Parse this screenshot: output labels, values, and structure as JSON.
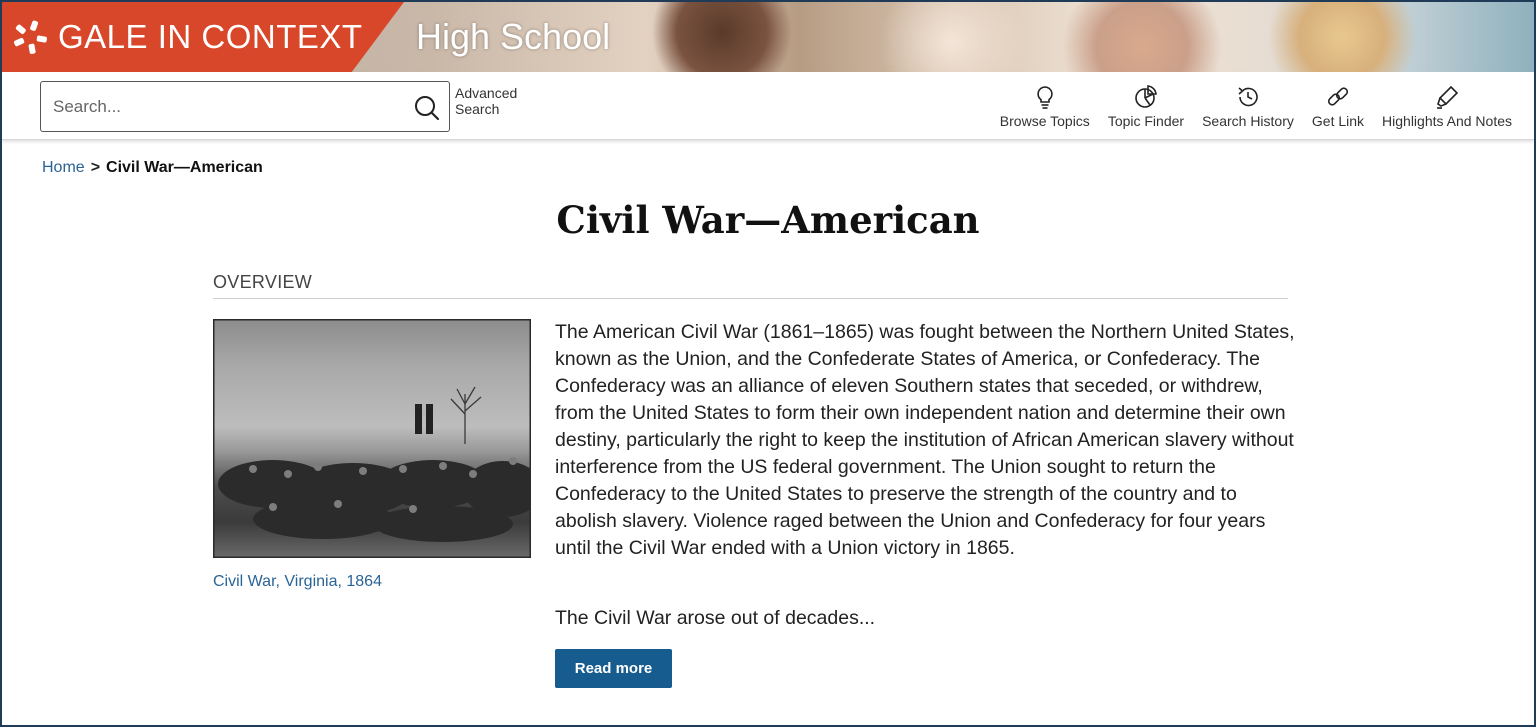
{
  "brand": {
    "name": "GALE IN CONTEXT",
    "edition": "High School",
    "accent": "#d9472b"
  },
  "search": {
    "placeholder": "Search...",
    "advanced_label": "Advanced Search"
  },
  "tools": [
    {
      "label": "Browse Topics",
      "icon": "lightbulb-icon"
    },
    {
      "label": "Topic Finder",
      "icon": "pie-chart-icon"
    },
    {
      "label": "Search History",
      "icon": "history-icon"
    },
    {
      "label": "Get Link",
      "icon": "link-icon"
    },
    {
      "label": "Highlights And Notes",
      "icon": "highlighter-icon"
    }
  ],
  "breadcrumb": {
    "home": "Home",
    "separator": ">",
    "current": "Civil War—American"
  },
  "page": {
    "title": "Civil War—American",
    "section": "OVERVIEW"
  },
  "figure": {
    "caption": "Civil War, Virginia, 1864"
  },
  "article": {
    "body": "The American Civil War (1861–1865) was fought between the Northern United States, known as the Union, and the Confederate States of America, or Confederacy. The Confederacy was an alliance of eleven Southern states that seceded, or withdrew, from the United States to form their own independent nation and determine their own destiny, particularly the right to keep the institution of African American slavery without interference from the US federal government. The Union sought to return the Confederacy to the United States to preserve the strength of the country and to abolish slavery. Violence raged between the Union and Confederacy for four years until the Civil War ended with a Union victory in 1865.",
    "teaser": "The Civil War arose out of decades...",
    "read_more_label": "Read more"
  },
  "colors": {
    "link": "#2a6496",
    "button": "#165c8f",
    "frame": "#1f3b57"
  }
}
